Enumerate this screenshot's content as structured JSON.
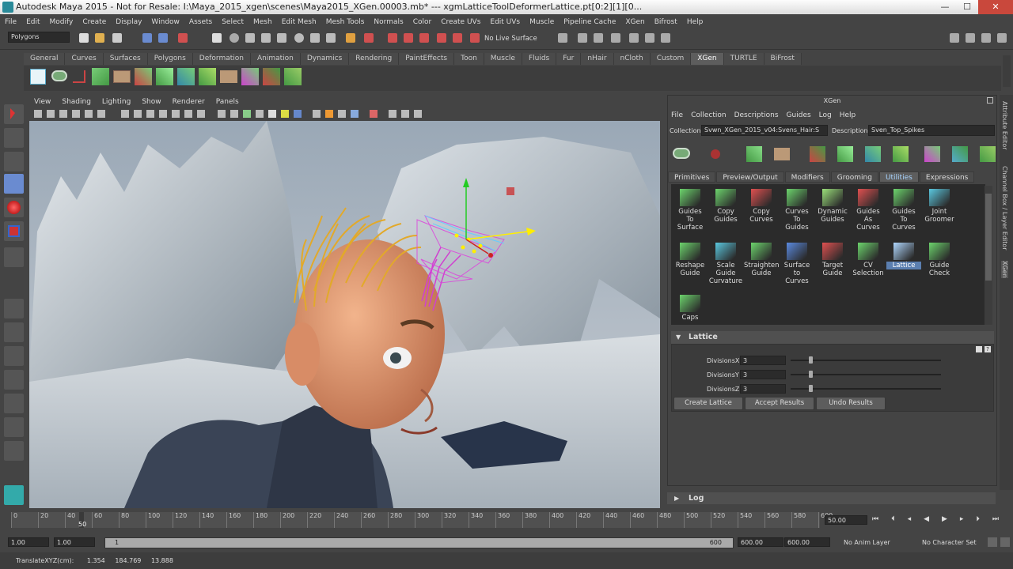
{
  "window": {
    "title": "Autodesk Maya 2015 - Not for Resale: I:\\Maya_2015_xgen\\scenes\\Maya2015_XGen.00003.mb*  ---  xgmLatticeToolDeformerLattice.pt[0:2][1][0...",
    "minimize": "—",
    "maximize": "☐",
    "close": "✕"
  },
  "menu": [
    "File",
    "Edit",
    "Modify",
    "Create",
    "Display",
    "Window",
    "Assets",
    "Select",
    "Mesh",
    "Edit Mesh",
    "Mesh Tools",
    "Normals",
    "Color",
    "Create UVs",
    "Edit UVs",
    "Muscle",
    "Pipeline Cache",
    "XGen",
    "Bifrost",
    "Help"
  ],
  "status_line": {
    "menu_set": "Polygons",
    "live_surface": "No Live Surface"
  },
  "shelf_tabs": [
    "General",
    "Curves",
    "Surfaces",
    "Polygons",
    "Deformation",
    "Animation",
    "Dynamics",
    "Rendering",
    "PaintEffects",
    "Toon",
    "Muscle",
    "Fluids",
    "Fur",
    "nHair",
    "nCloth",
    "Custom",
    "XGen",
    "TURTLE",
    "BiFrost"
  ],
  "shelf_active": "XGen",
  "viewport_menu": [
    "View",
    "Shading",
    "Lighting",
    "Show",
    "Renderer",
    "Panels"
  ],
  "xgen": {
    "panel_title": "XGen",
    "menu": [
      "File",
      "Collection",
      "Descriptions",
      "Guides",
      "Log",
      "Help"
    ],
    "collection_label": "Collection",
    "collection_value": "Svwn_XGen_2015_v04:Svens_Hair:S",
    "description_label": "Description",
    "description_value": "Sven_Top_Spikes",
    "tabs": [
      "Primitives",
      "Preview/Output",
      "Modifiers",
      "Grooming",
      "Utilities",
      "Expressions"
    ],
    "active_tab": "Utilities",
    "utilities": [
      {
        "label": "Guides To Surface",
        "lines": [
          "Guides",
          "To",
          "Surface"
        ],
        "color": "#6cd46c"
      },
      {
        "label": "Copy Guides",
        "lines": [
          "Copy",
          "Guides"
        ],
        "color": "#6cd46c"
      },
      {
        "label": "Copy Curves",
        "lines": [
          "Copy",
          "Curves"
        ],
        "color": "#e05050"
      },
      {
        "label": "Curves To Guides",
        "lines": [
          "Curves",
          "To",
          "Guides"
        ],
        "color": "#6cd46c"
      },
      {
        "label": "Dynamic Guides",
        "lines": [
          "Dynamic",
          "Guides"
        ],
        "color": "#9be07a"
      },
      {
        "label": "Guides As Curves",
        "lines": [
          "Guides",
          "As",
          "Curves"
        ],
        "color": "#e05050"
      },
      {
        "label": "Guides To Curves",
        "lines": [
          "Guides",
          "To",
          "Curves"
        ],
        "color": "#6cd46c"
      },
      {
        "label": "Joint Groomer",
        "lines": [
          "Joint",
          "Groomer"
        ],
        "color": "#5ac8e0"
      },
      {
        "label": "Reshape Guide",
        "lines": [
          "Reshape",
          "Guide"
        ],
        "color": "#6cd46c"
      },
      {
        "label": "Scale Guide Curvature",
        "lines": [
          "Scale",
          "Guide",
          "Curvature"
        ],
        "color": "#5ac8e0"
      },
      {
        "label": "Straighten Guide",
        "lines": [
          "Straighten",
          "Guide"
        ],
        "color": "#6cd46c"
      },
      {
        "label": "Surface to Curves",
        "lines": [
          "Surface",
          "to",
          "Curves"
        ],
        "color": "#5a8ae0"
      },
      {
        "label": "Target Guide",
        "lines": [
          "Target",
          "Guide"
        ],
        "color": "#e05050"
      },
      {
        "label": "CV Selection",
        "lines": [
          "CV",
          "Selection"
        ],
        "color": "#6cd46c"
      },
      {
        "label": "Lattice",
        "lines": [
          "Lattice"
        ],
        "color": "#b0d8ff"
      },
      {
        "label": "Guide Check",
        "lines": [
          "Guide",
          "Check"
        ],
        "color": "#6cd46c"
      },
      {
        "label": "Caps",
        "lines": [
          "Caps"
        ],
        "color": "#6cd46c"
      }
    ],
    "lattice": {
      "header": "Lattice",
      "divisions_x_label": "DivisionsX",
      "divisions_x": "3",
      "divisions_y_label": "DivisionsY",
      "divisions_y": "3",
      "divisions_z_label": "DivisionsZ",
      "divisions_z": "3",
      "create_button": "Create Lattice",
      "accept_button": "Accept Results",
      "undo_button": "Undo Results"
    },
    "log_label": "Log"
  },
  "right_tabs": [
    "Attribute Editor",
    "Channel Box / Layer Editor",
    "XGen"
  ],
  "timeline": {
    "ticks": [
      "0",
      "20",
      "40",
      "60",
      "80",
      "100",
      "120",
      "140",
      "160",
      "180",
      "200",
      "220",
      "240",
      "260",
      "280",
      "300",
      "320",
      "340",
      "360",
      "380",
      "400",
      "420",
      "440",
      "460",
      "480",
      "500",
      "520",
      "540",
      "560",
      "580",
      "600"
    ],
    "current_frame_marker": "50",
    "current_frame": "50.00"
  },
  "range": {
    "start": "1.00",
    "start_inner": "1.00",
    "range_start": "1",
    "range_end": "600",
    "end_inner": "600.00",
    "end": "600.00",
    "anim_layer": "No Anim Layer",
    "char_set": "No Character Set"
  },
  "status": {
    "label": "TranslateXYZ(cm):",
    "x": "1.354",
    "y": "184.769",
    "z": "13.888"
  },
  "colors": {
    "accent": "#5b7fb0",
    "bg": "#444444",
    "close": "#c9483c"
  }
}
